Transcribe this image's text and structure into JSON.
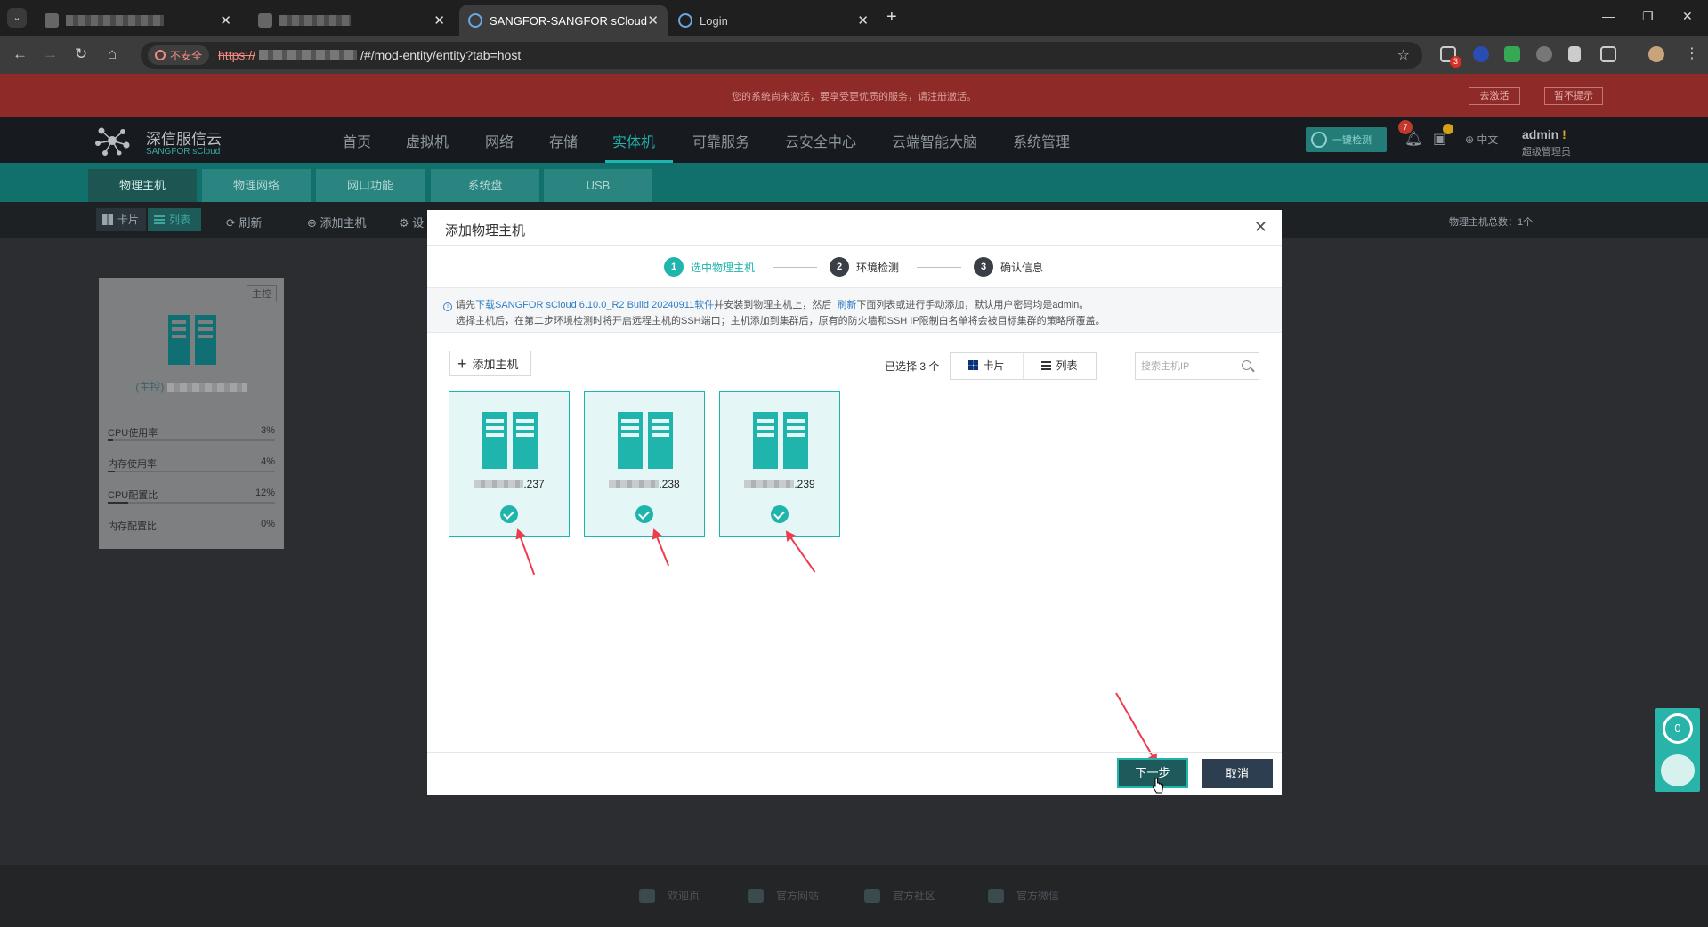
{
  "browser": {
    "tabs": [
      {
        "title": ""
      },
      {
        "title": ""
      },
      {
        "title": "SANGFOR-SANGFOR sCloud"
      },
      {
        "title": "Login"
      }
    ],
    "insecure_label": "不安全",
    "url_scheme": "https://",
    "url_path": "/#/mod-entity/entity?tab=host",
    "extension_badge": "3"
  },
  "banner": {
    "text": "您的系统尚未激活，要享受更优质的服务，请注册激活。",
    "activate_label": "去激活",
    "dismiss_label": "暂不提示"
  },
  "header": {
    "logo_cn": "深信服信云",
    "logo_en": "SANGFOR sCloud",
    "nav": [
      "首页",
      "虚拟机",
      "网络",
      "存储",
      "实体机",
      "可靠服务",
      "云安全中心",
      "云端智能大脑",
      "系统管理"
    ],
    "active_nav": "实体机",
    "check_label": "一键检测",
    "notification_count": "7",
    "language": "中文",
    "user_name": "admin",
    "user_warn": "!",
    "user_role": "超级管理员"
  },
  "subtabs": [
    "物理主机",
    "物理网络",
    "网口功能",
    "系统盘",
    "USB"
  ],
  "toolbar": {
    "card_label": "卡片",
    "list_label": "列表",
    "refresh_label": "刷新",
    "add_host_label": "添加主机",
    "settings_label": "设",
    "total_label": "物理主机总数：1个"
  },
  "bg_card": {
    "tag": "主控",
    "host_prefix": "(主控)",
    "metrics": [
      {
        "label": "CPU使用率",
        "value": "3%",
        "fill": 0.03
      },
      {
        "label": "内存使用率",
        "value": "4%",
        "fill": 0.04
      },
      {
        "label": "CPU配置比",
        "value": "12%",
        "fill": 0.12
      },
      {
        "label": "内存配置比",
        "value": "0%",
        "fill": 0
      }
    ]
  },
  "modal": {
    "title": "添加物理主机",
    "steps": [
      {
        "num": "1",
        "label": "选中物理主机"
      },
      {
        "num": "2",
        "label": "环境检测"
      },
      {
        "num": "3",
        "label": "确认信息"
      }
    ],
    "notice": {
      "line1_prefix": "请先",
      "download_link": "下载SANGFOR sCloud 6.10.0_R2 Build 20240911软件",
      "line1_mid": "并安装到物理主机上，然后",
      "refresh_link": "刷新",
      "line1_suffix": "下面列表或进行手动添加，默认用户密码均是admin。",
      "line2": "选择主机后，在第二步环境检测时将开启远程主机的SSH端口；主机添加到集群后，原有的防火墙和SSH IP限制白名单将会被目标集群的策略所覆盖。"
    },
    "add_host_label": "添加主机",
    "selected_label": "已选择 3 个",
    "view_card_label": "卡片",
    "view_list_label": "列表",
    "search_placeholder": "搜索主机IP",
    "hosts": [
      {
        "ip_suffix": ".237"
      },
      {
        "ip_suffix": ".238"
      },
      {
        "ip_suffix": ".239"
      }
    ],
    "next_label": "下一步",
    "cancel_label": "取消"
  },
  "footer": {
    "links": [
      "欢迎页",
      "官方网站",
      "官方社区",
      "官方微信"
    ]
  },
  "side_widget": {
    "count": "0"
  },
  "colors": {
    "accent": "#1fb5ac",
    "banner": "#8e2a28",
    "header_bg": "#171b1f",
    "arrow": "#ee3b4e"
  }
}
